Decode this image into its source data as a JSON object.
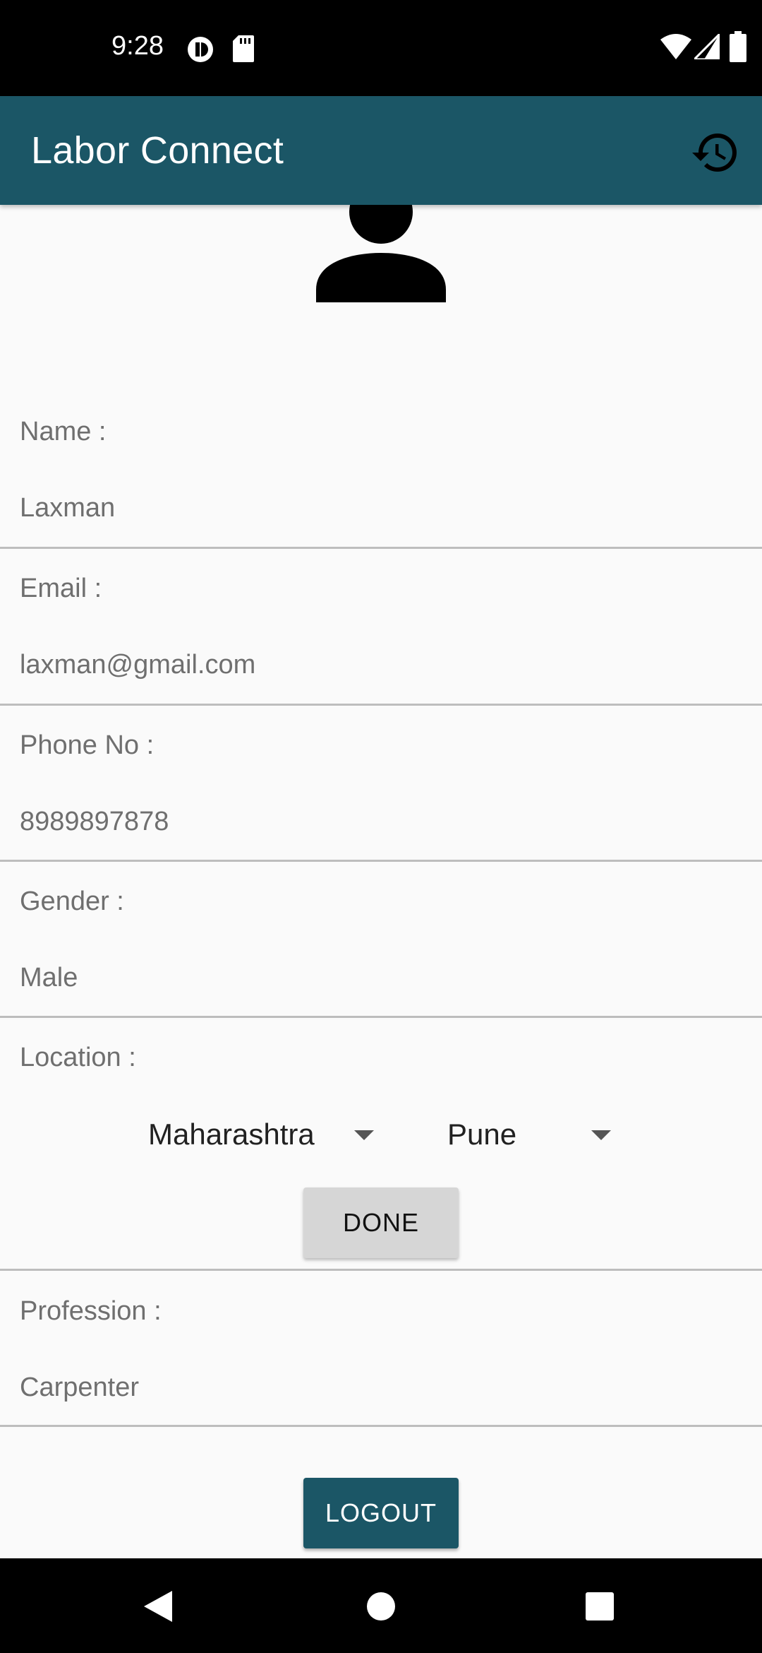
{
  "status_bar": {
    "time": "9:28",
    "left_icons": [
      "data-saver-icon",
      "sd-card-icon"
    ],
    "right_icons": [
      "wifi-icon",
      "cellular-signal-icon",
      "battery-icon"
    ]
  },
  "app_bar": {
    "title": "Labor Connect",
    "action_icon": "history-icon",
    "color": "#1b5666"
  },
  "profile": {
    "avatar_icon": "person-icon",
    "fields": [
      {
        "label": "Name :",
        "value": "Laxman"
      },
      {
        "label": "Email :",
        "value": "laxman@gmail.com"
      },
      {
        "label": "Phone No :",
        "value": "8989897878"
      },
      {
        "label": "Gender :",
        "value": "Male"
      }
    ],
    "location": {
      "label": "Location :",
      "state": "Maharashtra",
      "city": "Pune",
      "done_label": "DONE"
    },
    "profession": {
      "label": "Profession :",
      "value": "Carpenter"
    },
    "logout_label": "LOGOUT"
  },
  "nav_bar": {
    "icons": [
      "back-icon",
      "home-icon",
      "recents-icon"
    ]
  }
}
